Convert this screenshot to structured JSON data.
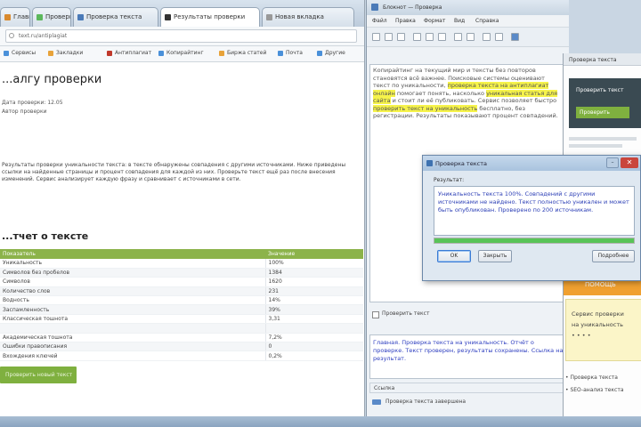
{
  "browser": {
    "tabs": [
      {
        "label": "Главная",
        "color": "#d98a2e"
      },
      {
        "label": "Проверка",
        "color": "#5cb85c"
      },
      {
        "label": "Проверка текста",
        "color": "#4a7ab8"
      },
      {
        "label": "Результаты проверки",
        "color": "#333333"
      },
      {
        "label": "Новая вкладка",
        "color": "#999999"
      }
    ],
    "address": "text.ru/antiplagiat",
    "bookmarks": [
      {
        "label": "Сервисы",
        "color": "#4a90d9"
      },
      {
        "label": "Закладки",
        "color": "#e8a33a"
      },
      {
        "label": "Антиплагиат",
        "color": "#c0392b"
      },
      {
        "label": "Копирайтинг",
        "color": "#4a90d9"
      },
      {
        "label": "Биржа статей",
        "color": "#e8a33a"
      },
      {
        "label": "Почта",
        "color": "#4a90d9"
      },
      {
        "label": "Другие",
        "color": "#4a90d9"
      }
    ]
  },
  "page": {
    "title": "...алгу проверки",
    "meta_date": "Дата проверки: 12.05",
    "meta_author": "Автор проверки",
    "paragraph": "Результаты проверки уникальности текста: в тексте обнаружены совпадения с другими источниками. Ниже приведены ссылки на найденные страницы и процент совпадения для каждой из них. Проверьте текст ещё раз после внесения изменений. Сервис анализирует каждую фразу и сравнивает с источниками в сети.",
    "section_title": "...тчет о тексте",
    "table_headers": [
      "Показатель",
      "Значение"
    ],
    "table_rows": [
      [
        "Уникальность",
        "100%"
      ],
      [
        "Символов без пробелов",
        "1384"
      ],
      [
        "Символов",
        "1620"
      ],
      [
        "Количество слов",
        "231"
      ],
      [
        "Водность",
        "14%"
      ],
      [
        "Заспамленность",
        "39%"
      ],
      [
        "Классическая тошнота",
        "3,31"
      ],
      [
        " ",
        " "
      ],
      [
        "Академическая тошнота",
        "7,2%"
      ],
      [
        "Ошибки правописания",
        "0"
      ],
      [
        "Вхождения ключей",
        "0,2%"
      ]
    ],
    "action_button": "Проверить новый текст"
  },
  "editor": {
    "title": "Блокнот — Проверка",
    "menu": [
      "Файл",
      "Правка",
      "Формат",
      "Вид",
      "Справка"
    ],
    "text_plain_1": "Копирайтинг на текущий мир и тексты без повторов становятся всё важнее. Поисковые системы оценивают текст по уникальности, ",
    "text_highlight_1": "проверка текста на антиплагиат онлайн",
    "text_plain_2": " помогает понять, насколько ",
    "text_highlight_2": "уникальная статья для сайта",
    "text_plain_3": " и стоит ли её публиковать. Сервис позволяет быстро ",
    "text_highlight_3": "проверить текст на уникальность",
    "text_plain_4": " бесплатно, без регистрации. Результаты показывают процент совпадений.",
    "checkbox_label": "Проверить текст",
    "blue_text": "Главная. Проверка текста на уникальность. Отчёт о проверке. Текст проверен, результаты сохранены. Ссылка на результат.",
    "bottom_field": "Ссылка",
    "footer": "Проверка текста завершена"
  },
  "third": {
    "header": "Проверка текста",
    "dark_label": "Проверить текст",
    "green_label": "Проверить",
    "orange_banner": "ПОМОЩЬ",
    "yellow_text_1": "Сервис проверки",
    "yellow_text_2": "на уникальность",
    "yellow_text_3": "• • • •",
    "list_1": "• Проверка текста",
    "list_2": "• SEO-анализ текста"
  },
  "dialog": {
    "title": "Проверка текста",
    "label": "Результат:",
    "text": "Уникальность текста 100%. Совпадений с другими источниками не найдено. Текст полностью уникален и может быть опубликован. Проверено по 200 источникам.",
    "progress": 1.0,
    "ok_label": "OK",
    "close_label": "Закрыть",
    "extra_label": "Подробнее"
  }
}
